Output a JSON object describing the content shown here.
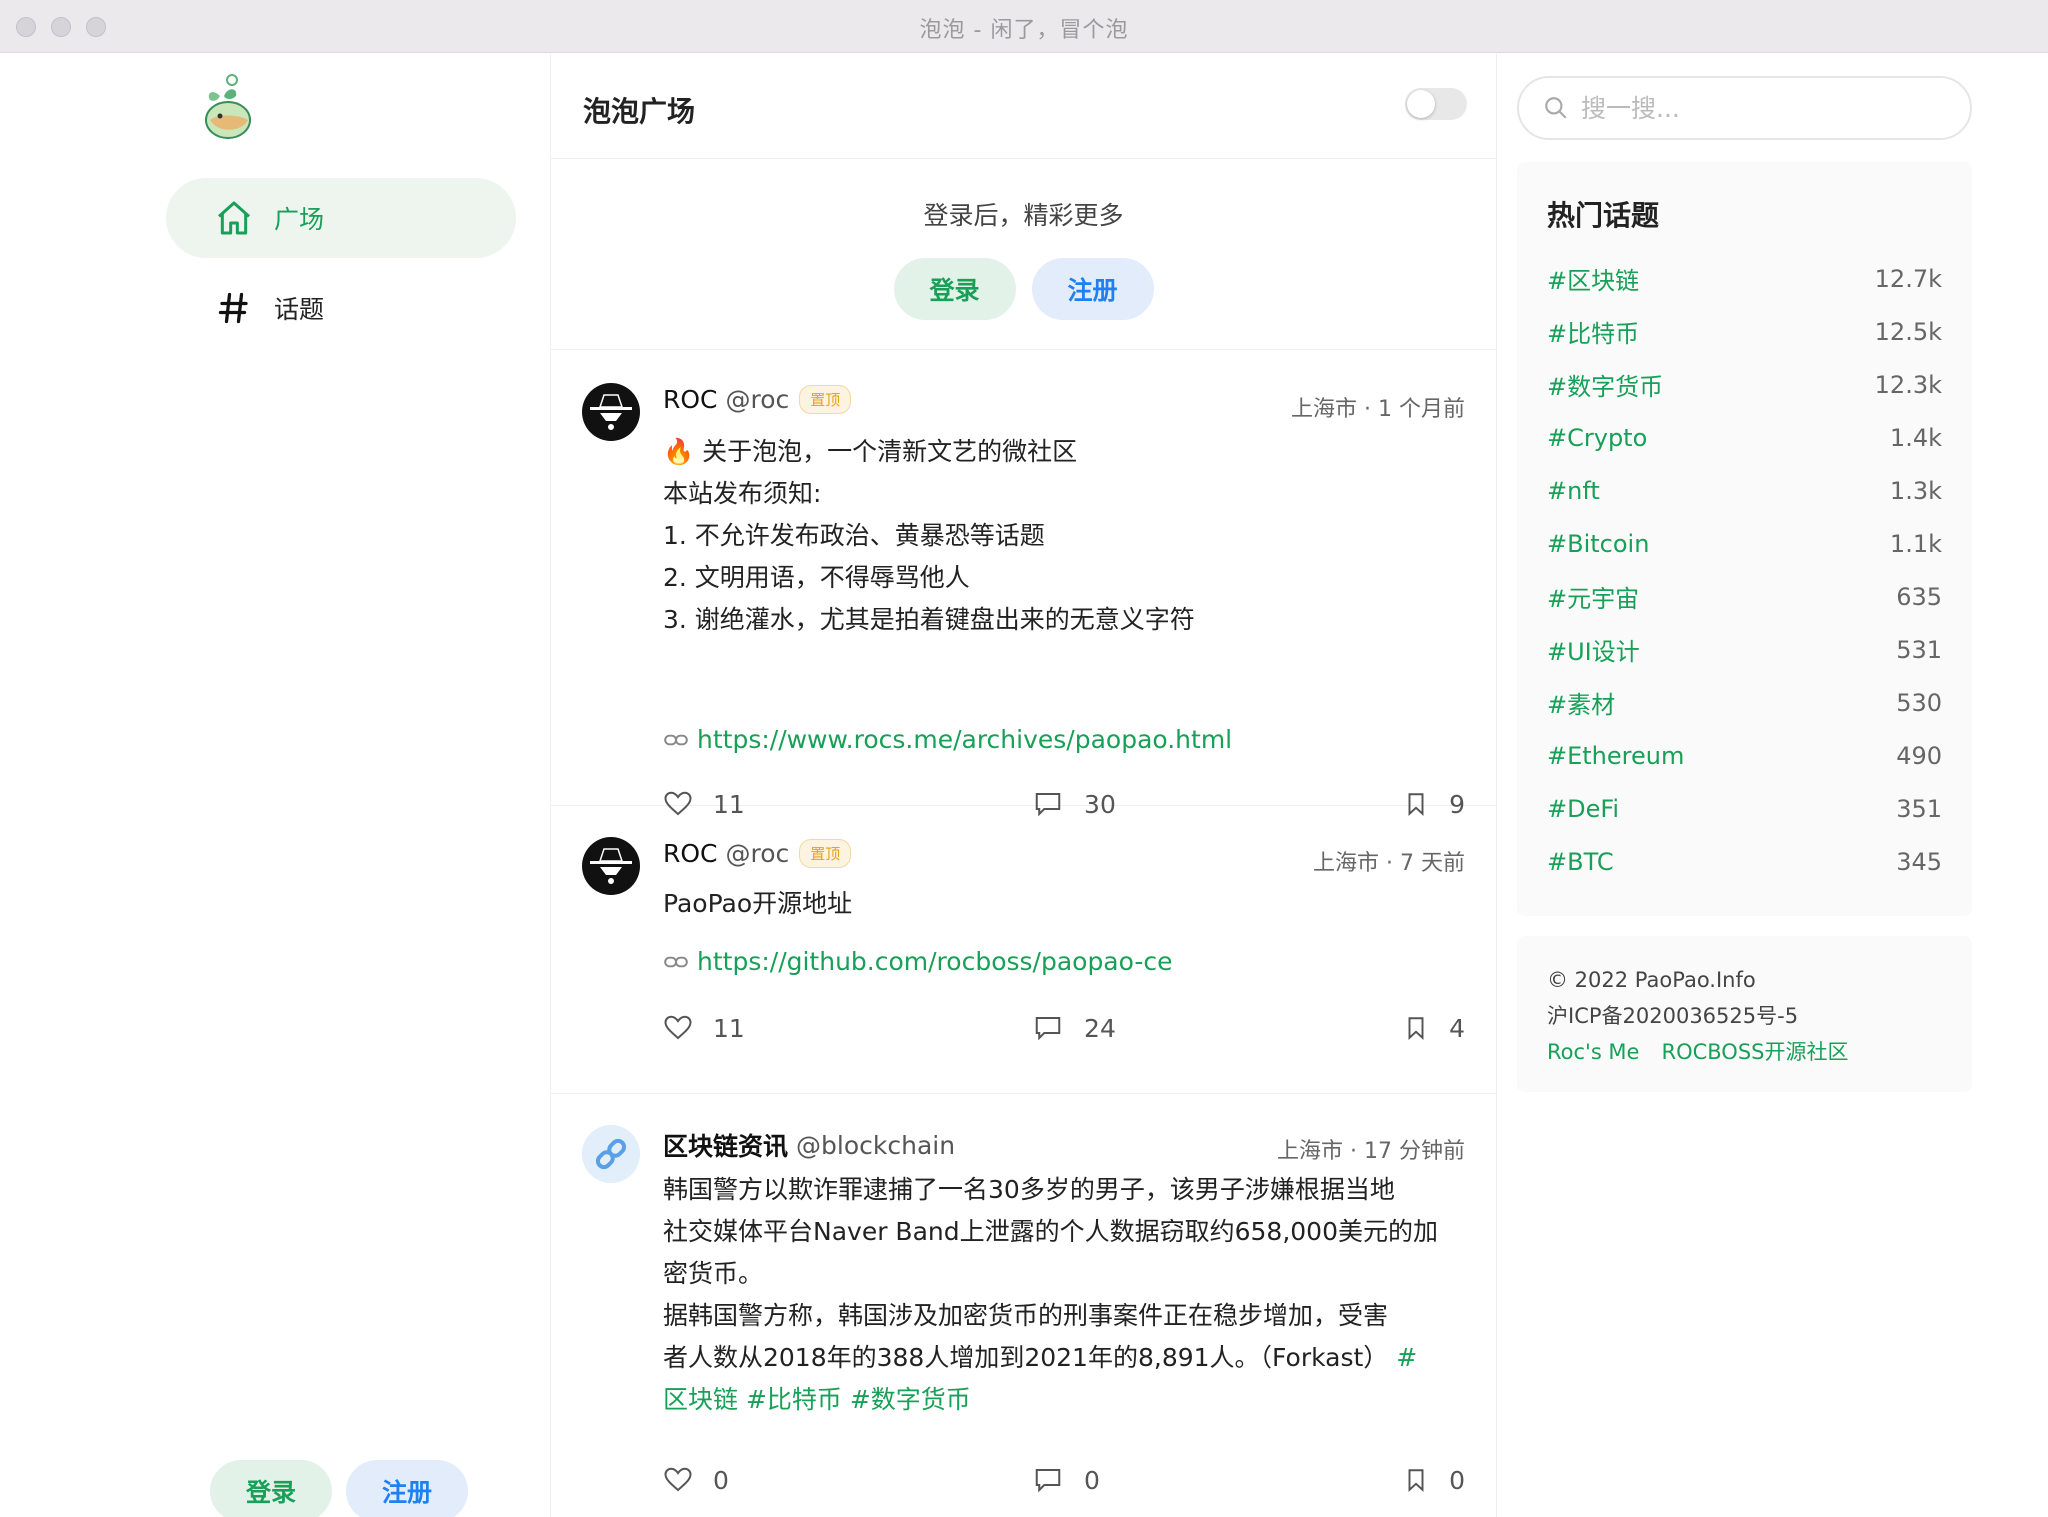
{
  "window": {
    "title": "泡泡 - 闲了，冒个泡"
  },
  "sidebar": {
    "items": [
      {
        "label": "广场",
        "icon": "home-icon",
        "active": true
      },
      {
        "label": "话题",
        "icon": "hash-icon",
        "active": false
      }
    ],
    "login_label": "登录",
    "register_label": "注册"
  },
  "main": {
    "title": "泡泡广场",
    "auth_tip": "登录后，精彩更多",
    "login_label": "登录",
    "register_label": "注册"
  },
  "posts": [
    {
      "name": "ROC",
      "username": "@roc",
      "pin": "置顶",
      "meta": "上海市 · 1 个月前",
      "lines": [
        "🔥 关于泡泡，一个清新文艺的微社区",
        "本站发布须知:",
        "1. 不允许发布政治、黄暴恐等话题",
        "2. 文明用语，不得辱骂他人",
        "3. 谢绝灌水，尤其是拍着键盘出来的无意义字符"
      ],
      "link": "https://www.rocs.me/archives/paopao.html",
      "likes": "11",
      "comments": "30",
      "collections": "9"
    },
    {
      "name": "ROC",
      "username": "@roc",
      "pin": "置顶",
      "meta": "上海市 · 7 天前",
      "lines": [
        "PaoPao开源地址"
      ],
      "link": "https://github.com/rocboss/paopao-ce",
      "likes": "11",
      "comments": "24",
      "collections": "4"
    },
    {
      "name": "区块链资讯",
      "username": "@blockchain",
      "meta": "上海市 · 17 分钟前",
      "lines": [
        "韩国警方以欺诈罪逮捕了一名30多岁的男子，该男子涉嫌根据当地",
        "社交媒体平台Naver Band上泄露的个人数据窃取约658,000美元的加",
        "密货币。",
        "据韩国警方称，韩国涉及加密货币的刑事案件正在稳步增加，受害",
        "者人数从2018年的388人增加到2021年的8,891人。（Forkast）"
      ],
      "tag_inline": "#",
      "tags_line": "区块链 #比特币 #数字货币",
      "likes": "0",
      "comments": "0",
      "collections": "0"
    }
  ],
  "search": {
    "placeholder": "搜一搜..."
  },
  "hot_topics": {
    "title": "热门话题",
    "items": [
      {
        "name": "#区块链",
        "count": "12.7k"
      },
      {
        "name": "#比特币",
        "count": "12.5k"
      },
      {
        "name": "#数字货币",
        "count": "12.3k"
      },
      {
        "name": "#Crypto",
        "count": "1.4k"
      },
      {
        "name": "#nft",
        "count": "1.3k"
      },
      {
        "name": "#Bitcoin",
        "count": "1.1k"
      },
      {
        "name": "#元宇宙",
        "count": "635"
      },
      {
        "name": "#UI设计",
        "count": "531"
      },
      {
        "name": "#素材",
        "count": "530"
      },
      {
        "name": "#Ethereum",
        "count": "490"
      },
      {
        "name": "#DeFi",
        "count": "351"
      },
      {
        "name": "#BTC",
        "count": "345"
      }
    ]
  },
  "footer": {
    "copyright": "© 2022 PaoPao.Info",
    "icp": "沪ICP备2020036525号-5",
    "link1": "Roc's Me",
    "link2": "ROCBOSS开源社区"
  },
  "colors": {
    "accent": "#18a058",
    "blue": "#2080f0"
  }
}
